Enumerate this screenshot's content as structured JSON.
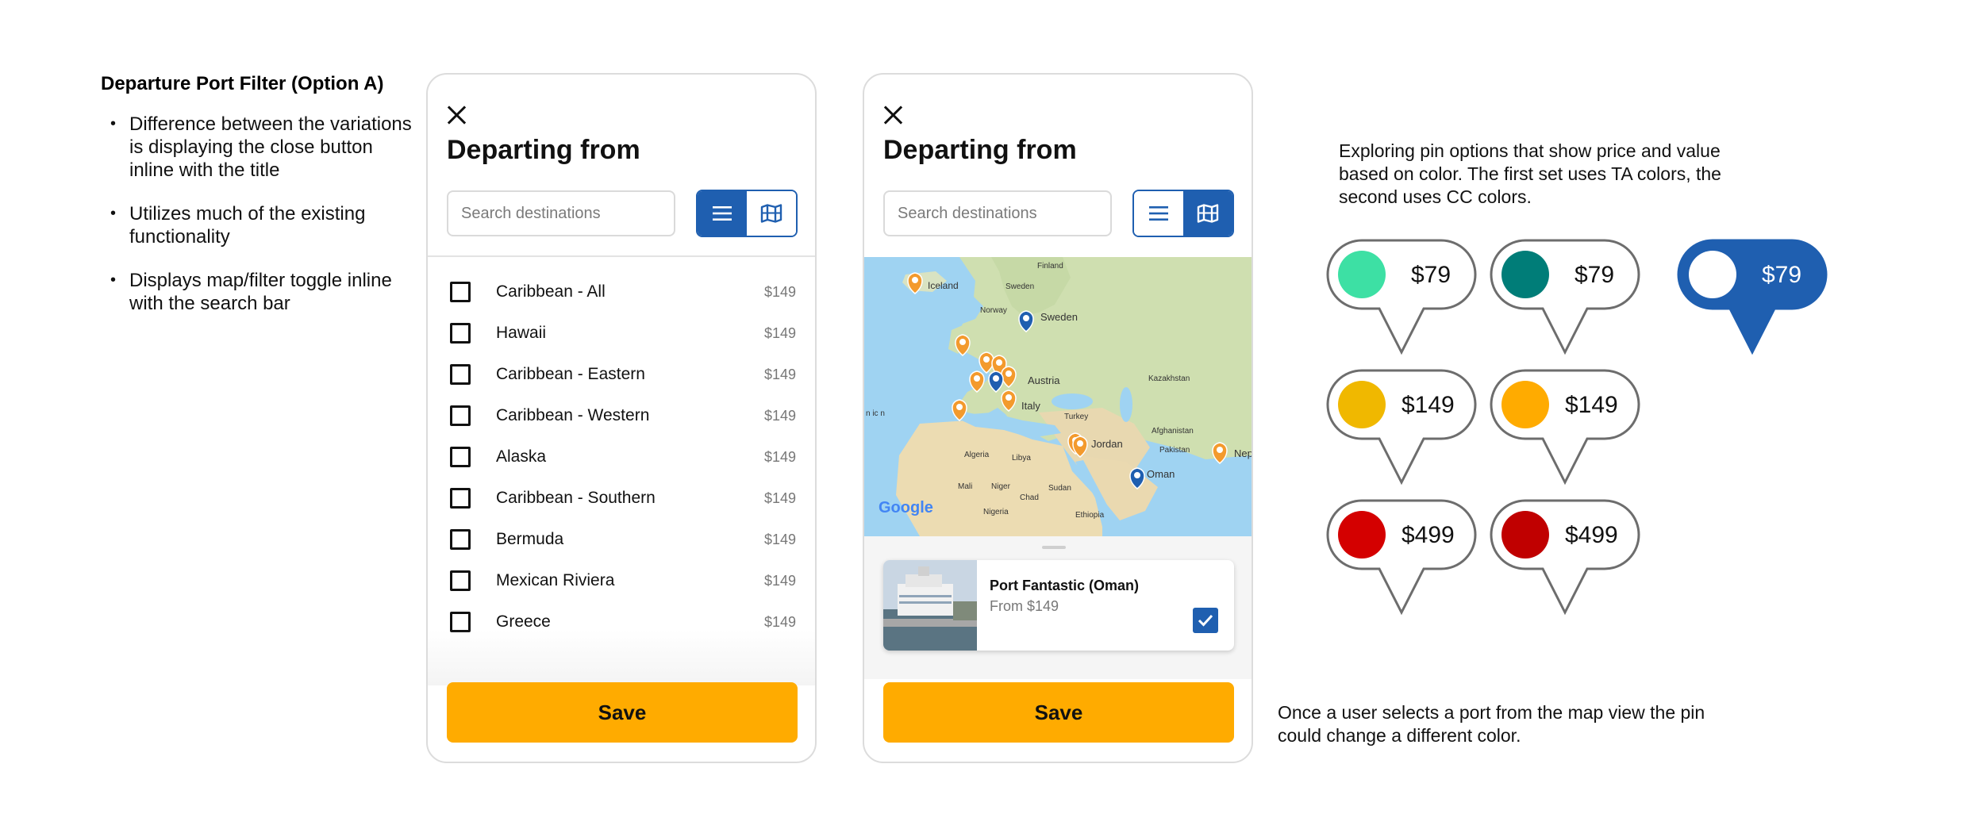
{
  "notes": {
    "title": "Departure Port Filter (Option A)",
    "bullets": [
      "Difference between the variations is displaying the close button inline with the title",
      "Utilizes much of the existing functionality",
      "Displays map/filter toggle inline with the search bar"
    ]
  },
  "phone_list": {
    "title": "Departing from",
    "search_placeholder": "Search destinations",
    "view_mode": "list",
    "items": [
      {
        "label": "Caribbean - All",
        "price": "$149"
      },
      {
        "label": "Hawaii",
        "price": "$149"
      },
      {
        "label": "Caribbean - Eastern",
        "price": "$149"
      },
      {
        "label": "Caribbean - Western",
        "price": "$149"
      },
      {
        "label": "Alaska",
        "price": "$149"
      },
      {
        "label": "Caribbean - Southern",
        "price": "$149"
      },
      {
        "label": "Bermuda",
        "price": "$149"
      },
      {
        "label": "Mexican Riviera",
        "price": "$149"
      },
      {
        "label": "Greece",
        "price": "$149"
      }
    ],
    "save_label": "Save"
  },
  "phone_map": {
    "title": "Departing from",
    "search_placeholder": "Search destinations",
    "view_mode": "map",
    "map_labels": {
      "iceland": "Iceland",
      "finland": "Finland",
      "sweden_small": "Sweden",
      "sweden": "Sweden",
      "norway": "Norway",
      "austria": "Austria",
      "kazakhstan": "Kazakhstan",
      "turkey": "Turkey",
      "italy": "Italy",
      "afghanistan": "Afghanistan",
      "jordan": "Jordan",
      "pakistan": "Pakistan",
      "nepal": "Nep",
      "algeria": "Algeria",
      "libya": "Libya",
      "oman": "Oman",
      "mali": "Mali",
      "niger": "Niger",
      "sudan": "Sudan",
      "chad": "Chad",
      "nigeria": "Nigeria",
      "ethiopia": "Ethiopia",
      "left_edge": "n\nic\nn",
      "google": "Google"
    },
    "selected_port": {
      "name": "Port Fantastic (Oman)",
      "price": "From $149",
      "selected": true
    },
    "save_label": "Save"
  },
  "pins": {
    "explanation": "Exploring pin options that show price and value based on color. The first set uses TA colors, the second uses CC colors.",
    "set_ta": [
      {
        "price": "$79",
        "color": "#3de0a4"
      },
      {
        "price": "$149",
        "color": "#f0b800"
      },
      {
        "price": "$499",
        "color": "#d40000"
      }
    ],
    "set_cc": [
      {
        "price": "$79",
        "color": "#007d78"
      },
      {
        "price": "$149",
        "color": "#ffab00"
      },
      {
        "price": "$499",
        "color": "#c00000"
      }
    ],
    "selected_pin": {
      "price": "$79",
      "color": "#1f5fb0"
    },
    "selection_note": "Once a user selects a port from the map view the pin could change a different color."
  },
  "colors": {
    "primary_blue": "#1f5fb0",
    "save_yellow": "#ffab00",
    "map_pin_orange": "#f39a2d"
  }
}
